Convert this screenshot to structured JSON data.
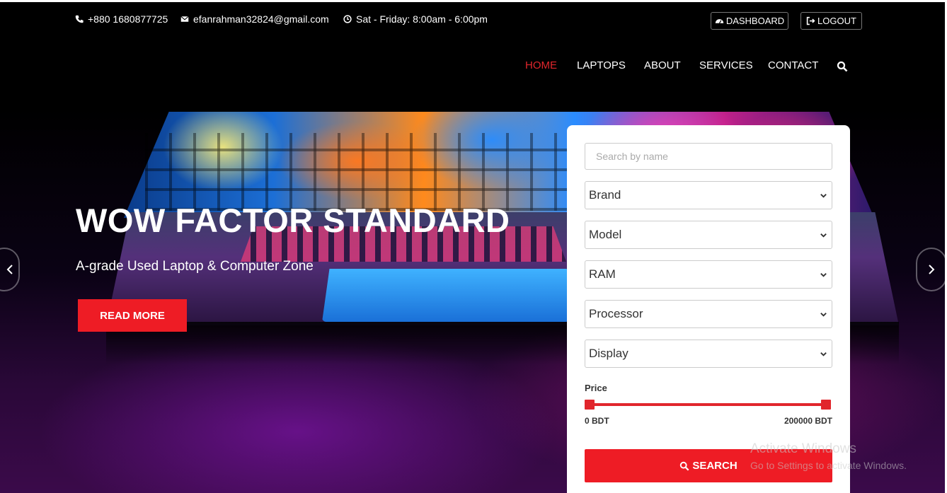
{
  "topbar": {
    "phone": "+880 1680877725",
    "email": "efanrahman32824@gmail.com",
    "hours": "Sat - Friday: 8:00am - 6:00pm",
    "dashboard_label": "DASHBOARD",
    "logout_label": "LOGOUT"
  },
  "nav": {
    "items": [
      {
        "label": "HOME",
        "active": true
      },
      {
        "label": "LAPTOPS",
        "active": false
      },
      {
        "label": "ABOUT",
        "active": false
      },
      {
        "label": "SERVICES",
        "active": false
      },
      {
        "label": "CONTACT",
        "active": false
      }
    ]
  },
  "hero": {
    "headline": "WOW FACTOR STANDARD",
    "subline": "A-grade Used Laptop & Computer Zone",
    "read_more_label": "READ MORE"
  },
  "filter": {
    "search_placeholder": "Search by name",
    "selects": [
      {
        "label": "Brand"
      },
      {
        "label": "Model"
      },
      {
        "label": "RAM"
      },
      {
        "label": "Processor"
      },
      {
        "label": "Display"
      }
    ],
    "price_label": "Price",
    "price_min": "0 BDT",
    "price_max": "200000 BDT",
    "price_range_fraction": [
      0,
      1
    ],
    "search_label": "SEARCH"
  },
  "watermark": {
    "title": "Activate Windows",
    "subtitle": "Go to Settings to activate Windows."
  },
  "colors": {
    "accent": "#ee1c25",
    "nav_active": "#e1262c",
    "background": "#000000"
  },
  "icons": {
    "phone": "phone-icon",
    "email": "envelope-icon",
    "hours": "clock-icon",
    "dashboard": "dashboard-icon",
    "logout": "logout-icon",
    "nav_search": "search-icon",
    "select_caret": "chevron-down-icon"
  }
}
